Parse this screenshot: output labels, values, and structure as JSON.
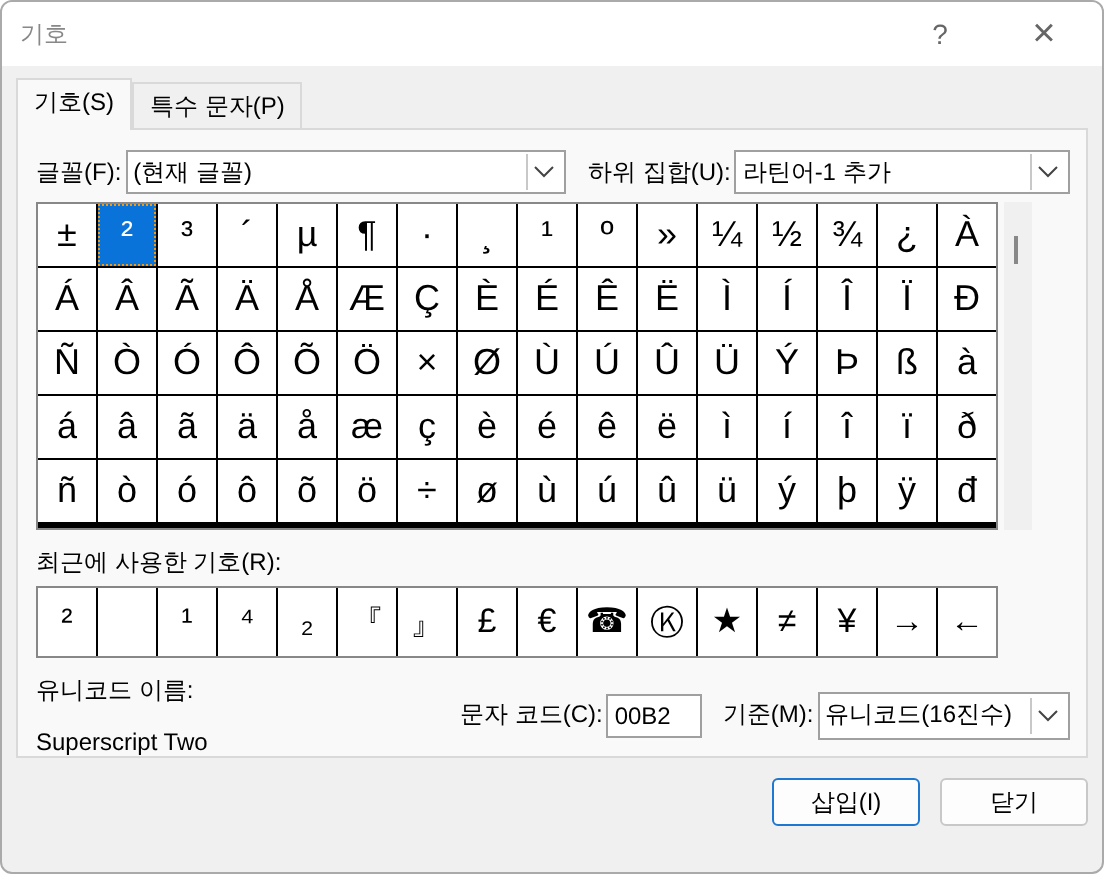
{
  "window": {
    "title": "기호",
    "help": "?",
    "close": "×"
  },
  "tabs": [
    {
      "label": "기호(S)",
      "selected": true
    },
    {
      "label": "특수 문자(P)",
      "selected": false
    }
  ],
  "font": {
    "label": "글꼴(F):",
    "value": "(현재 글꼴)"
  },
  "subset": {
    "label": "하위 집합(U):",
    "value": "라틴어-1 추가"
  },
  "grid": [
    [
      {
        "c": "±",
        "selected": false
      },
      {
        "c": "²",
        "selected": true
      },
      {
        "c": "³",
        "selected": false
      },
      {
        "c": "´",
        "selected": false
      },
      {
        "c": "µ",
        "selected": false
      },
      {
        "c": "¶",
        "selected": false
      },
      {
        "c": "·",
        "selected": false
      },
      {
        "c": "¸",
        "selected": false
      },
      {
        "c": "¹",
        "selected": false
      },
      {
        "c": "º",
        "selected": false
      },
      {
        "c": "»",
        "selected": false
      },
      {
        "c": "¼",
        "selected": false
      },
      {
        "c": "½",
        "selected": false
      },
      {
        "c": "¾",
        "selected": false
      },
      {
        "c": "¿",
        "selected": false
      },
      {
        "c": "À",
        "selected": false
      }
    ],
    [
      {
        "c": "Á",
        "selected": false
      },
      {
        "c": "Â",
        "selected": false
      },
      {
        "c": "Ã",
        "selected": false
      },
      {
        "c": "Ä",
        "selected": false
      },
      {
        "c": "Å",
        "selected": false
      },
      {
        "c": "Æ",
        "selected": false
      },
      {
        "c": "Ç",
        "selected": false
      },
      {
        "c": "È",
        "selected": false
      },
      {
        "c": "É",
        "selected": false
      },
      {
        "c": "Ê",
        "selected": false
      },
      {
        "c": "Ë",
        "selected": false
      },
      {
        "c": "Ì",
        "selected": false
      },
      {
        "c": "Í",
        "selected": false
      },
      {
        "c": "Î",
        "selected": false
      },
      {
        "c": "Ï",
        "selected": false
      },
      {
        "c": "Ð",
        "selected": false
      }
    ],
    [
      {
        "c": "Ñ",
        "selected": false
      },
      {
        "c": "Ò",
        "selected": false
      },
      {
        "c": "Ó",
        "selected": false
      },
      {
        "c": "Ô",
        "selected": false
      },
      {
        "c": "Õ",
        "selected": false
      },
      {
        "c": "Ö",
        "selected": false
      },
      {
        "c": "×",
        "selected": false
      },
      {
        "c": "Ø",
        "selected": false
      },
      {
        "c": "Ù",
        "selected": false
      },
      {
        "c": "Ú",
        "selected": false
      },
      {
        "c": "Û",
        "selected": false
      },
      {
        "c": "Ü",
        "selected": false
      },
      {
        "c": "Ý",
        "selected": false
      },
      {
        "c": "Þ",
        "selected": false
      },
      {
        "c": "ß",
        "selected": false
      },
      {
        "c": "à",
        "selected": false
      }
    ],
    [
      {
        "c": "á",
        "selected": false
      },
      {
        "c": "â",
        "selected": false
      },
      {
        "c": "ã",
        "selected": false
      },
      {
        "c": "ä",
        "selected": false
      },
      {
        "c": "å",
        "selected": false
      },
      {
        "c": "æ",
        "selected": false
      },
      {
        "c": "ç",
        "selected": false
      },
      {
        "c": "è",
        "selected": false
      },
      {
        "c": "é",
        "selected": false
      },
      {
        "c": "ê",
        "selected": false
      },
      {
        "c": "ë",
        "selected": false
      },
      {
        "c": "ì",
        "selected": false
      },
      {
        "c": "í",
        "selected": false
      },
      {
        "c": "î",
        "selected": false
      },
      {
        "c": "ï",
        "selected": false
      },
      {
        "c": "ð",
        "selected": false
      }
    ],
    [
      {
        "c": "ñ",
        "selected": false
      },
      {
        "c": "ò",
        "selected": false
      },
      {
        "c": "ó",
        "selected": false
      },
      {
        "c": "ô",
        "selected": false
      },
      {
        "c": "õ",
        "selected": false
      },
      {
        "c": "ö",
        "selected": false
      },
      {
        "c": "÷",
        "selected": false
      },
      {
        "c": "ø",
        "selected": false
      },
      {
        "c": "ù",
        "selected": false
      },
      {
        "c": "ú",
        "selected": false
      },
      {
        "c": "û",
        "selected": false
      },
      {
        "c": "ü",
        "selected": false
      },
      {
        "c": "ý",
        "selected": false
      },
      {
        "c": "þ",
        "selected": false
      },
      {
        "c": "ÿ",
        "selected": false
      },
      {
        "c": "đ",
        "selected": false
      }
    ]
  ],
  "recent": {
    "label": "최근에 사용한 기호(R):",
    "items": [
      {
        "kind": "char",
        "c": "²"
      },
      {
        "kind": "blank"
      },
      {
        "kind": "char",
        "c": "¹"
      },
      {
        "kind": "char",
        "c": "⁴"
      },
      {
        "kind": "char",
        "c": "₂"
      },
      {
        "kind": "char",
        "c": "『"
      },
      {
        "kind": "char",
        "c": "』"
      },
      {
        "kind": "char",
        "c": "£"
      },
      {
        "kind": "char",
        "c": "€"
      },
      {
        "kind": "char",
        "c": "☎"
      },
      {
        "kind": "char",
        "c": "Ⓚ"
      },
      {
        "kind": "char",
        "c": "★"
      },
      {
        "kind": "char",
        "c": "≠"
      },
      {
        "kind": "char",
        "c": "¥"
      },
      {
        "kind": "char",
        "c": "→"
      },
      {
        "kind": "char",
        "c": "←"
      }
    ]
  },
  "unicode_name": {
    "label": "유니코드 이름:",
    "value": "Superscript Two"
  },
  "char_code": {
    "label": "문자 코드(C):",
    "value": "00B2"
  },
  "from": {
    "label": "기준(M):",
    "value": "유니코드(16진수)"
  },
  "buttons": [
    {
      "label": "삽입(I)",
      "default": true
    },
    {
      "label": "닫기",
      "default": false
    }
  ]
}
